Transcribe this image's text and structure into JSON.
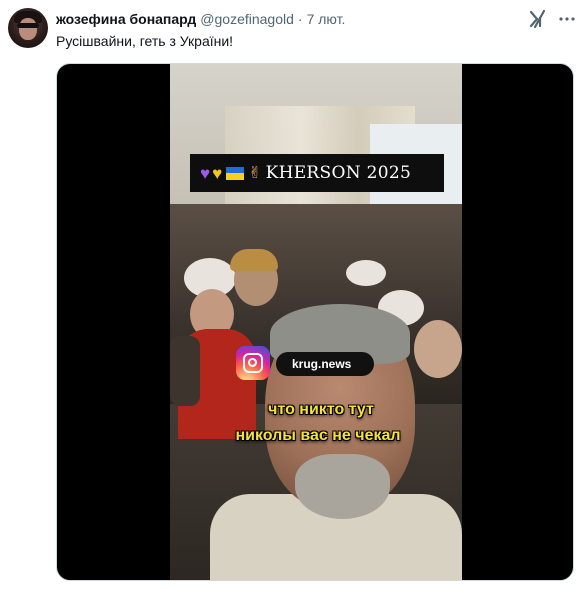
{
  "tweet": {
    "display_name": "жозефина бонапард",
    "handle": "@gozefinagold",
    "separator": "·",
    "time": "7 лют.",
    "text": "Русішвайни, геть з України!"
  },
  "media": {
    "banner_text": "KHERSON 2025",
    "instagram_label": "krug.news",
    "caption_line1": "что никто тут",
    "caption_line2": "николы вас не чекал"
  },
  "icons": {
    "grok": "grok-icon",
    "more": "more-icon",
    "instagram": "instagram-icon",
    "hearts": [
      "purple-heart-icon",
      "yellow-heart-icon"
    ],
    "flag": "ukraine-flag-icon",
    "victory": "victory-hand-icon"
  },
  "colors": {
    "text_primary": "#0f1419",
    "text_secondary": "#536471",
    "caption_yellow": "#f5e23a",
    "media_background": "#000000"
  }
}
